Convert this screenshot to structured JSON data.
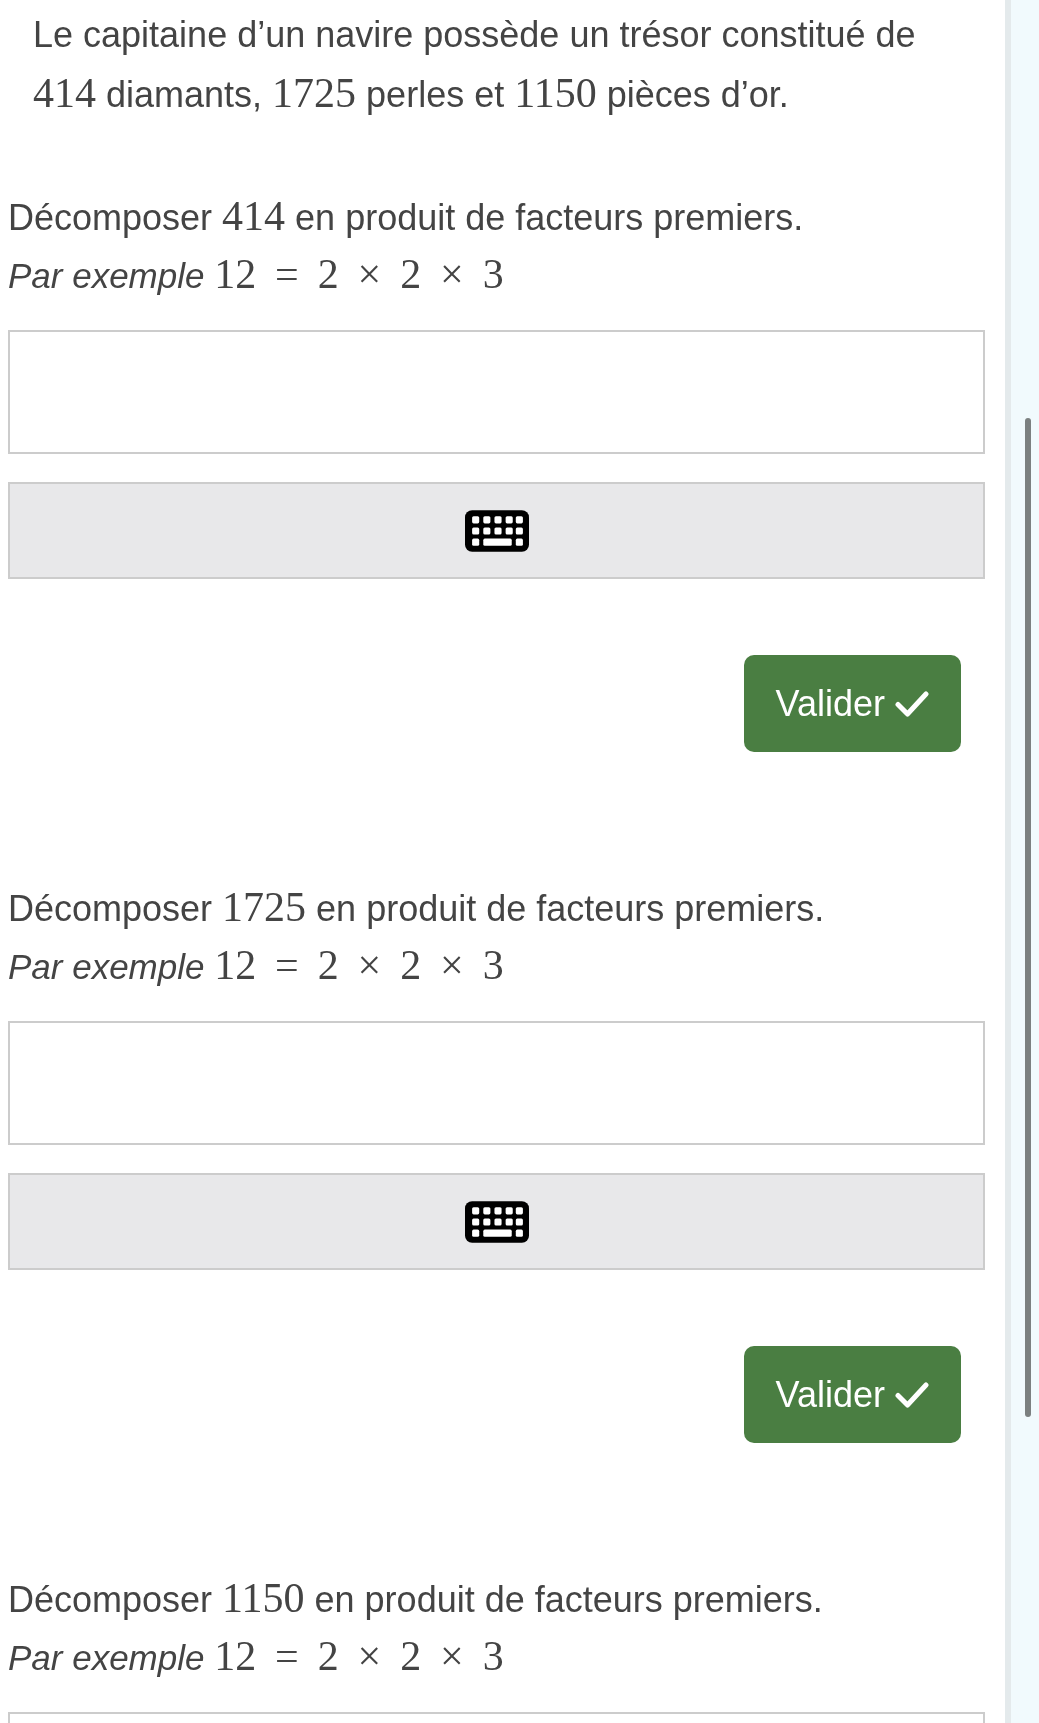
{
  "intro": [
    {
      "kind": "text",
      "text": "Le capitaine d’un navire possède un trésor constitué de "
    },
    {
      "kind": "math",
      "text": "414"
    },
    {
      "kind": "text",
      "text": " diamants, "
    },
    {
      "kind": "math",
      "text": "1725"
    },
    {
      "kind": "text",
      "text": " perles et "
    },
    {
      "kind": "math",
      "text": "1150"
    },
    {
      "kind": "text",
      "text": " pièces d’or."
    }
  ],
  "questions": [
    {
      "prompt": [
        {
          "kind": "text",
          "text": "Décomposer "
        },
        {
          "kind": "math",
          "text": "414"
        },
        {
          "kind": "text",
          "text": " en produit de facteurs premiers."
        }
      ],
      "example": [
        {
          "kind": "italic",
          "text": "Par exemple "
        },
        {
          "kind": "math",
          "text": "12 = 2 × 2 × 3"
        }
      ],
      "controls": [
        {
          "kind": "keyboard"
        },
        {
          "kind": "button",
          "label": "Valider"
        }
      ]
    },
    {
      "prompt": [
        {
          "kind": "text",
          "text": "Décomposer "
        },
        {
          "kind": "math",
          "text": "1725"
        },
        {
          "kind": "text",
          "text": " en produit de facteurs premiers."
        }
      ],
      "example": [
        {
          "kind": "italic",
          "text": "Par exemple "
        },
        {
          "kind": "math",
          "text": "12 = 2 × 2 × 3"
        }
      ],
      "controls": [
        {
          "kind": "keyboard"
        },
        {
          "kind": "button",
          "label": "Valider"
        }
      ]
    },
    {
      "prompt": [
        {
          "kind": "text",
          "text": "Décomposer "
        },
        {
          "kind": "math",
          "text": "1150"
        },
        {
          "kind": "text",
          "text": " en produit de facteurs premiers."
        }
      ],
      "example": [
        {
          "kind": "italic",
          "text": "Par exemple "
        },
        {
          "kind": "math",
          "text": "12 = 2 × 2 × 3"
        }
      ]
    }
  ]
}
